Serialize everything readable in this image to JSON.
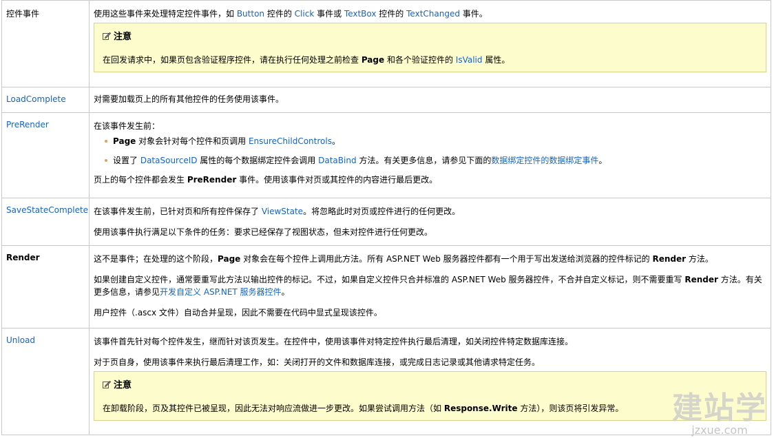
{
  "rows": [
    {
      "name": "控件事件",
      "paragraphs": [
        [
          "使用这些事件来处理特定控件事件，如 ",
          "Button",
          " 控件的 ",
          "Click",
          " 事件或 ",
          "TextBox",
          " 控件的 ",
          "TextChanged",
          " 事件。"
        ]
      ],
      "note": {
        "title": "注意",
        "text": [
          "在回发请求中，如果页包含验证程序控件，请在执行任何处理之前检查 ",
          "Page",
          " 和各个验证控件的 ",
          "IsValid",
          " 属性。"
        ]
      }
    },
    {
      "name": "LoadComplete",
      "text": "对需要加载页上的所有其他控件的任务使用该事件。"
    },
    {
      "name": "PreRender",
      "intro": "在该事件发生前：",
      "bullets": [
        [
          "Page",
          " 对象会针对每个控件和页调用 ",
          "EnsureChildControls",
          "。"
        ],
        [
          "设置了 ",
          "DataSourceID",
          " 属性的每个数据绑定控件会调用 ",
          "DataBind",
          " 方法。有关更多信息，请参见下面的",
          "数据绑定控件的数据绑定事件",
          "。"
        ]
      ],
      "after": [
        "页上的每个控件都会发生 ",
        "PreRender",
        " 事件。使用该事件对页或其控件的内容进行最后更改。"
      ]
    },
    {
      "name": "SaveStateComplete",
      "p1": [
        "在该事件发生前，已针对页和所有控件保存了 ",
        "ViewState",
        "。将忽略此时对页或控件进行的任何更改。"
      ],
      "p2": "使用该事件执行满足以下条件的任务：要求已经保存了视图状态，但未对控件进行任何更改。"
    },
    {
      "name": "Render",
      "p1": [
        "这不是事件；在处理的这个阶段，",
        "Page",
        " 对象会在每个控件上调用此方法。所有 ASP.NET Web 服务器控件都有一个用于写出发送给浏览器的控件标记的 ",
        "Render",
        " 方法。"
      ],
      "p2": [
        "如果创建自定义控件，通常要重写此方法以输出控件的标记。不过，如果自定义控件只合并标准的 ASP.NET Web 服务器控件，不合并自定义标记，则不需要重写 ",
        "Render",
        " 方法。有关更多信息，请参见",
        "开发自定义 ASP.NET 服务器控件",
        "。"
      ],
      "p3": "用户控件（.ascx 文件）自动合并呈现，因此不需要在代码中显式呈现该控件。"
    },
    {
      "name": "Unload",
      "p1": "该事件首先针对每个控件发生，继而针对该页发生。在控件中，使用该事件对特定控件执行最后清理，如关闭控件特定数据库连接。",
      "p2": "对于页自身，使用该事件来执行最后清理工作，如：关闭打开的文件和数据库连接，或完成日志记录或其他请求特定任务。",
      "note": {
        "title": "注意",
        "text": [
          "在卸载阶段，页及其控件已被呈现，因此无法对响应流做进一步更改。如果尝试调用方法（如 ",
          "Response.Write",
          " 方法），则该页将引发异常。"
        ]
      }
    }
  ],
  "watermark": {
    "cn": "建站学",
    "en": "jzxue.com"
  },
  "colors": {
    "link": "#1364c4",
    "note_bg": "#fdfccd",
    "border": "#c8c8c8"
  }
}
